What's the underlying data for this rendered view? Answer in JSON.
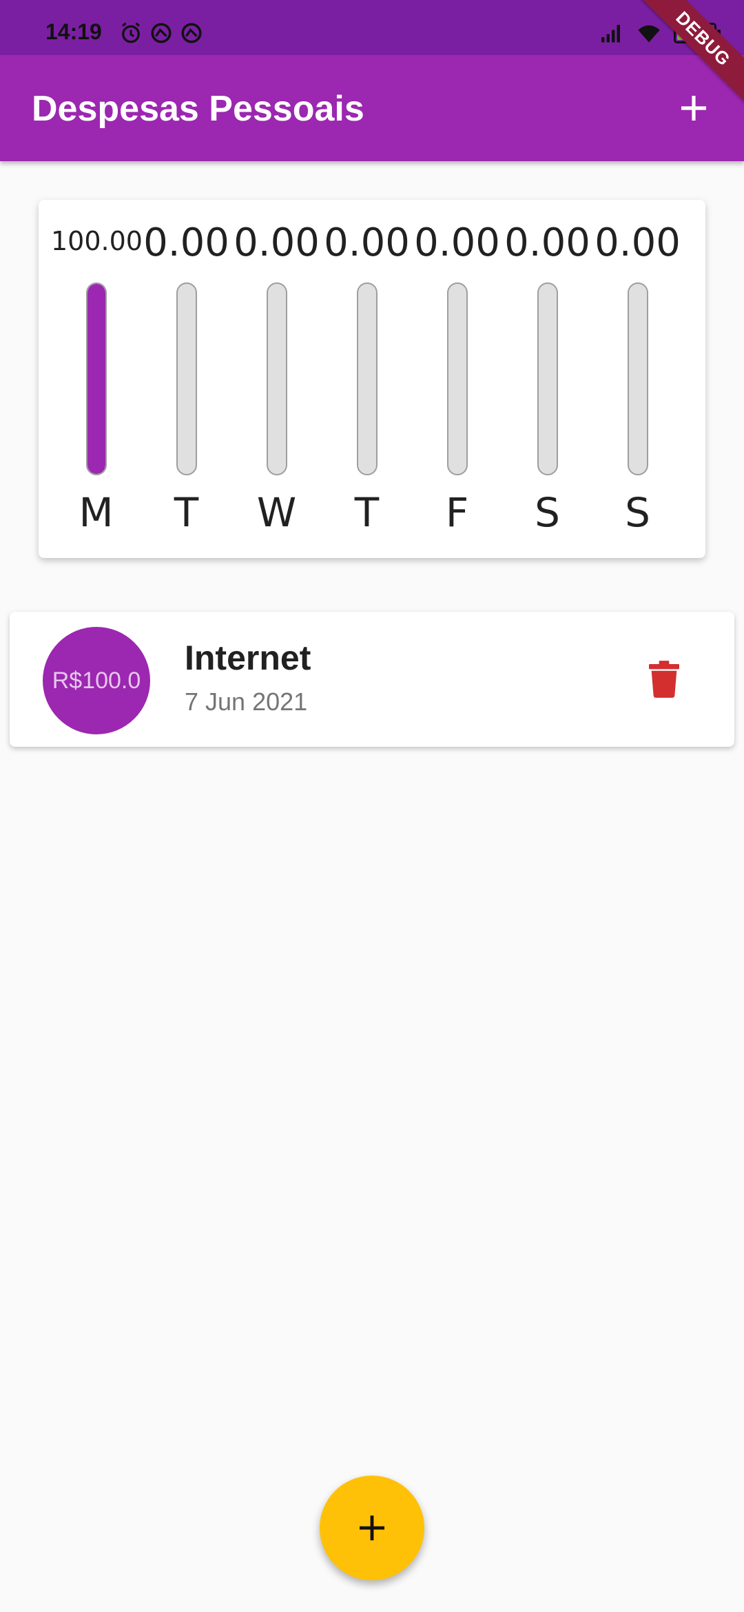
{
  "status_bar": {
    "time": "14:19",
    "battery": "99",
    "left_icons": [
      "alarm-icon",
      "data-saver-icon",
      "data-saver-icon"
    ],
    "right_icons": [
      "signal-icon",
      "wifi-icon",
      "battery-icon"
    ]
  },
  "debug_banner": "DEBUG",
  "app_bar": {
    "title": "Despesas Pessoais",
    "action_icon": "plus-icon"
  },
  "chart_data": {
    "type": "bar",
    "categories": [
      "M",
      "T",
      "W",
      "T",
      "F",
      "S",
      "S"
    ],
    "values": [
      100.0,
      0.0,
      0.0,
      0.0,
      0.0,
      0.0,
      0.0
    ],
    "value_labels": [
      "100.00",
      "0.00",
      "0.00",
      "0.00",
      "0.00",
      "0.00",
      "0.00"
    ],
    "fill_fraction": [
      1.0,
      0,
      0,
      0,
      0,
      0,
      0
    ],
    "bar_color": "#9c27b0",
    "track_color": "#e0e0e0"
  },
  "transactions": [
    {
      "amount": "R$100.0",
      "title": "Internet",
      "date": "7 Jun 2021",
      "delete_icon": "trash-icon"
    }
  ],
  "fab": {
    "icon": "plus-icon",
    "color": "#ffc107"
  },
  "colors": {
    "primary": "#9c27b0",
    "primary_dark": "#7b1fa2",
    "accent": "#ffc107",
    "danger": "#d32f2f"
  }
}
